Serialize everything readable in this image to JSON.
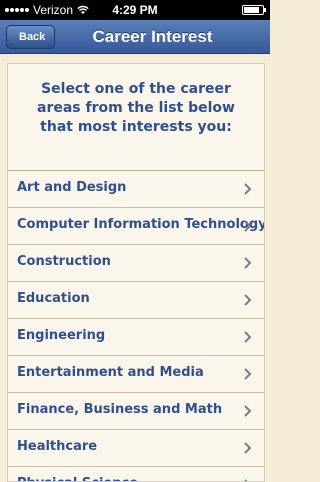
{
  "status_bar": {
    "carrier": "Verizon",
    "time": "4:29 PM",
    "battery_level": 0.85
  },
  "nav": {
    "back_label": "Back",
    "title": "Career Interest"
  },
  "intro_text": "Select one of the career areas from the list below that most interests you:",
  "career_areas": [
    {
      "label": "Art and Design"
    },
    {
      "label": "Computer Information Technology"
    },
    {
      "label": "Construction"
    },
    {
      "label": "Education"
    },
    {
      "label": "Engineering"
    },
    {
      "label": "Entertainment and Media"
    },
    {
      "label": "Finance, Business and Math"
    },
    {
      "label": "Healthcare"
    },
    {
      "label": "Physical Science"
    }
  ],
  "colors": {
    "nav_bar": "#35599a",
    "text": "#2f4f8f",
    "background": "#f5ecd8"
  },
  "icons": {
    "row_accessory": "chevron-right-icon",
    "wifi": "wifi-icon",
    "battery": "battery-icon"
  }
}
